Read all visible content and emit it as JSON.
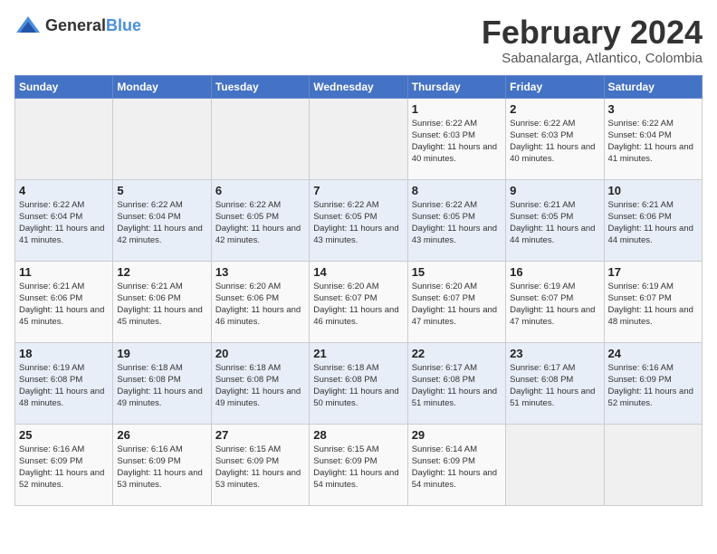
{
  "header": {
    "logo_general": "General",
    "logo_blue": "Blue",
    "title": "February 2024",
    "subtitle": "Sabanalarga, Atlantico, Colombia"
  },
  "days_of_week": [
    "Sunday",
    "Monday",
    "Tuesday",
    "Wednesday",
    "Thursday",
    "Friday",
    "Saturday"
  ],
  "weeks": [
    [
      {
        "day": "",
        "info": ""
      },
      {
        "day": "",
        "info": ""
      },
      {
        "day": "",
        "info": ""
      },
      {
        "day": "",
        "info": ""
      },
      {
        "day": "1",
        "info": "Sunrise: 6:22 AM\nSunset: 6:03 PM\nDaylight: 11 hours\nand 40 minutes."
      },
      {
        "day": "2",
        "info": "Sunrise: 6:22 AM\nSunset: 6:03 PM\nDaylight: 11 hours\nand 40 minutes."
      },
      {
        "day": "3",
        "info": "Sunrise: 6:22 AM\nSunset: 6:04 PM\nDaylight: 11 hours\nand 41 minutes."
      }
    ],
    [
      {
        "day": "4",
        "info": "Sunrise: 6:22 AM\nSunset: 6:04 PM\nDaylight: 11 hours\nand 41 minutes."
      },
      {
        "day": "5",
        "info": "Sunrise: 6:22 AM\nSunset: 6:04 PM\nDaylight: 11 hours\nand 42 minutes."
      },
      {
        "day": "6",
        "info": "Sunrise: 6:22 AM\nSunset: 6:05 PM\nDaylight: 11 hours\nand 42 minutes."
      },
      {
        "day": "7",
        "info": "Sunrise: 6:22 AM\nSunset: 6:05 PM\nDaylight: 11 hours\nand 43 minutes."
      },
      {
        "day": "8",
        "info": "Sunrise: 6:22 AM\nSunset: 6:05 PM\nDaylight: 11 hours\nand 43 minutes."
      },
      {
        "day": "9",
        "info": "Sunrise: 6:21 AM\nSunset: 6:05 PM\nDaylight: 11 hours\nand 44 minutes."
      },
      {
        "day": "10",
        "info": "Sunrise: 6:21 AM\nSunset: 6:06 PM\nDaylight: 11 hours\nand 44 minutes."
      }
    ],
    [
      {
        "day": "11",
        "info": "Sunrise: 6:21 AM\nSunset: 6:06 PM\nDaylight: 11 hours\nand 45 minutes."
      },
      {
        "day": "12",
        "info": "Sunrise: 6:21 AM\nSunset: 6:06 PM\nDaylight: 11 hours\nand 45 minutes."
      },
      {
        "day": "13",
        "info": "Sunrise: 6:20 AM\nSunset: 6:06 PM\nDaylight: 11 hours\nand 46 minutes."
      },
      {
        "day": "14",
        "info": "Sunrise: 6:20 AM\nSunset: 6:07 PM\nDaylight: 11 hours\nand 46 minutes."
      },
      {
        "day": "15",
        "info": "Sunrise: 6:20 AM\nSunset: 6:07 PM\nDaylight: 11 hours\nand 47 minutes."
      },
      {
        "day": "16",
        "info": "Sunrise: 6:19 AM\nSunset: 6:07 PM\nDaylight: 11 hours\nand 47 minutes."
      },
      {
        "day": "17",
        "info": "Sunrise: 6:19 AM\nSunset: 6:07 PM\nDaylight: 11 hours\nand 48 minutes."
      }
    ],
    [
      {
        "day": "18",
        "info": "Sunrise: 6:19 AM\nSunset: 6:08 PM\nDaylight: 11 hours\nand 48 minutes."
      },
      {
        "day": "19",
        "info": "Sunrise: 6:18 AM\nSunset: 6:08 PM\nDaylight: 11 hours\nand 49 minutes."
      },
      {
        "day": "20",
        "info": "Sunrise: 6:18 AM\nSunset: 6:08 PM\nDaylight: 11 hours\nand 49 minutes."
      },
      {
        "day": "21",
        "info": "Sunrise: 6:18 AM\nSunset: 6:08 PM\nDaylight: 11 hours\nand 50 minutes."
      },
      {
        "day": "22",
        "info": "Sunrise: 6:17 AM\nSunset: 6:08 PM\nDaylight: 11 hours\nand 51 minutes."
      },
      {
        "day": "23",
        "info": "Sunrise: 6:17 AM\nSunset: 6:08 PM\nDaylight: 11 hours\nand 51 minutes."
      },
      {
        "day": "24",
        "info": "Sunrise: 6:16 AM\nSunset: 6:09 PM\nDaylight: 11 hours\nand 52 minutes."
      }
    ],
    [
      {
        "day": "25",
        "info": "Sunrise: 6:16 AM\nSunset: 6:09 PM\nDaylight: 11 hours\nand 52 minutes."
      },
      {
        "day": "26",
        "info": "Sunrise: 6:16 AM\nSunset: 6:09 PM\nDaylight: 11 hours\nand 53 minutes."
      },
      {
        "day": "27",
        "info": "Sunrise: 6:15 AM\nSunset: 6:09 PM\nDaylight: 11 hours\nand 53 minutes."
      },
      {
        "day": "28",
        "info": "Sunrise: 6:15 AM\nSunset: 6:09 PM\nDaylight: 11 hours\nand 54 minutes."
      },
      {
        "day": "29",
        "info": "Sunrise: 6:14 AM\nSunset: 6:09 PM\nDaylight: 11 hours\nand 54 minutes."
      },
      {
        "day": "",
        "info": ""
      },
      {
        "day": "",
        "info": ""
      }
    ]
  ]
}
